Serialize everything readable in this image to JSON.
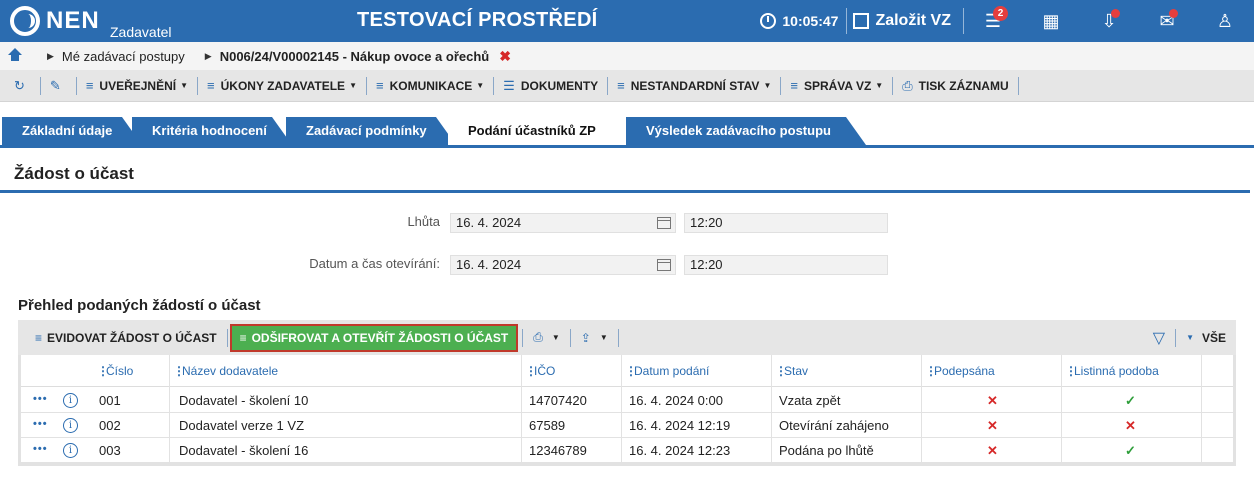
{
  "header": {
    "logo_text": "NEN",
    "logo_sub": "Zadavatel",
    "env_title": "TESTOVACÍ PROSTŘEDÍ",
    "clock": "10:05:47",
    "new_vz_label": "Založit VZ",
    "notifications_count": "2",
    "icons": [
      "menu-icon",
      "calculator-icon",
      "inbox-icon",
      "mail-icon",
      "user-icon"
    ]
  },
  "breadcrumb": {
    "items": [
      "Mé zadávací postupy",
      "N006/24/V00002145 - Nákup ovoce a ořechů"
    ],
    "close_glyph": "✖"
  },
  "actionbar": {
    "items": [
      "UVEŘEJNĚNÍ",
      "ÚKONY ZADAVATELE",
      "KOMUNIKACE",
      "DOKUMENTY",
      "NESTANDARDNÍ STAV",
      "SPRÁVA VZ",
      "TISK ZÁZNAMU"
    ]
  },
  "tabs": [
    {
      "label": "Základní údaje",
      "active": false
    },
    {
      "label": "Kritéria hodnocení",
      "active": false
    },
    {
      "label": "Zadávací podmínky",
      "active": false
    },
    {
      "label": "Podání účastníků ZP",
      "active": true
    },
    {
      "label": "Výsledek zadávacího postupu",
      "active": false
    }
  ],
  "section": {
    "title": "Žádost o účast",
    "deadline_label": "Lhůta",
    "deadline_date": "16. 4. 2024",
    "deadline_time": "12:20",
    "opening_label": "Datum a čas otevírání:",
    "opening_date": "16. 4. 2024",
    "opening_time": "12:20"
  },
  "grid": {
    "title": "Přehled podaných žádostí o účast",
    "toolbar": {
      "record_label": "EVIDOVAT ŽÁDOST O ÚČAST",
      "decrypt_label": "ODŠIFROVAT A OTEVŘÍT ŽÁDOSTI O ÚČAST",
      "all_label": "VŠE"
    },
    "columns": [
      "Číslo",
      "Název dodavatele",
      "IČO",
      "Datum podání",
      "Stav",
      "Podepsána",
      "Listinná podoba"
    ],
    "rows": [
      {
        "cislo": "001",
        "nazev": "Dodavatel - školení 10",
        "ico": "14707420",
        "datum": "16. 4. 2024 0:00",
        "stav": "Vzata zpět",
        "podepsana": "✕",
        "listinna": "✓"
      },
      {
        "cislo": "002",
        "nazev": "Dodavatel verze 1 VZ",
        "ico": "67589",
        "datum": "16. 4. 2024 12:19",
        "stav": "Otevírání zahájeno",
        "podepsana": "✕",
        "listinna": "✕"
      },
      {
        "cislo": "003",
        "nazev": "Dodavatel - školení 16",
        "ico": "12346789",
        "datum": "16. 4. 2024 12:23",
        "stav": "Podána po lhůtě",
        "podepsana": "✕",
        "listinna": "✓"
      }
    ]
  }
}
